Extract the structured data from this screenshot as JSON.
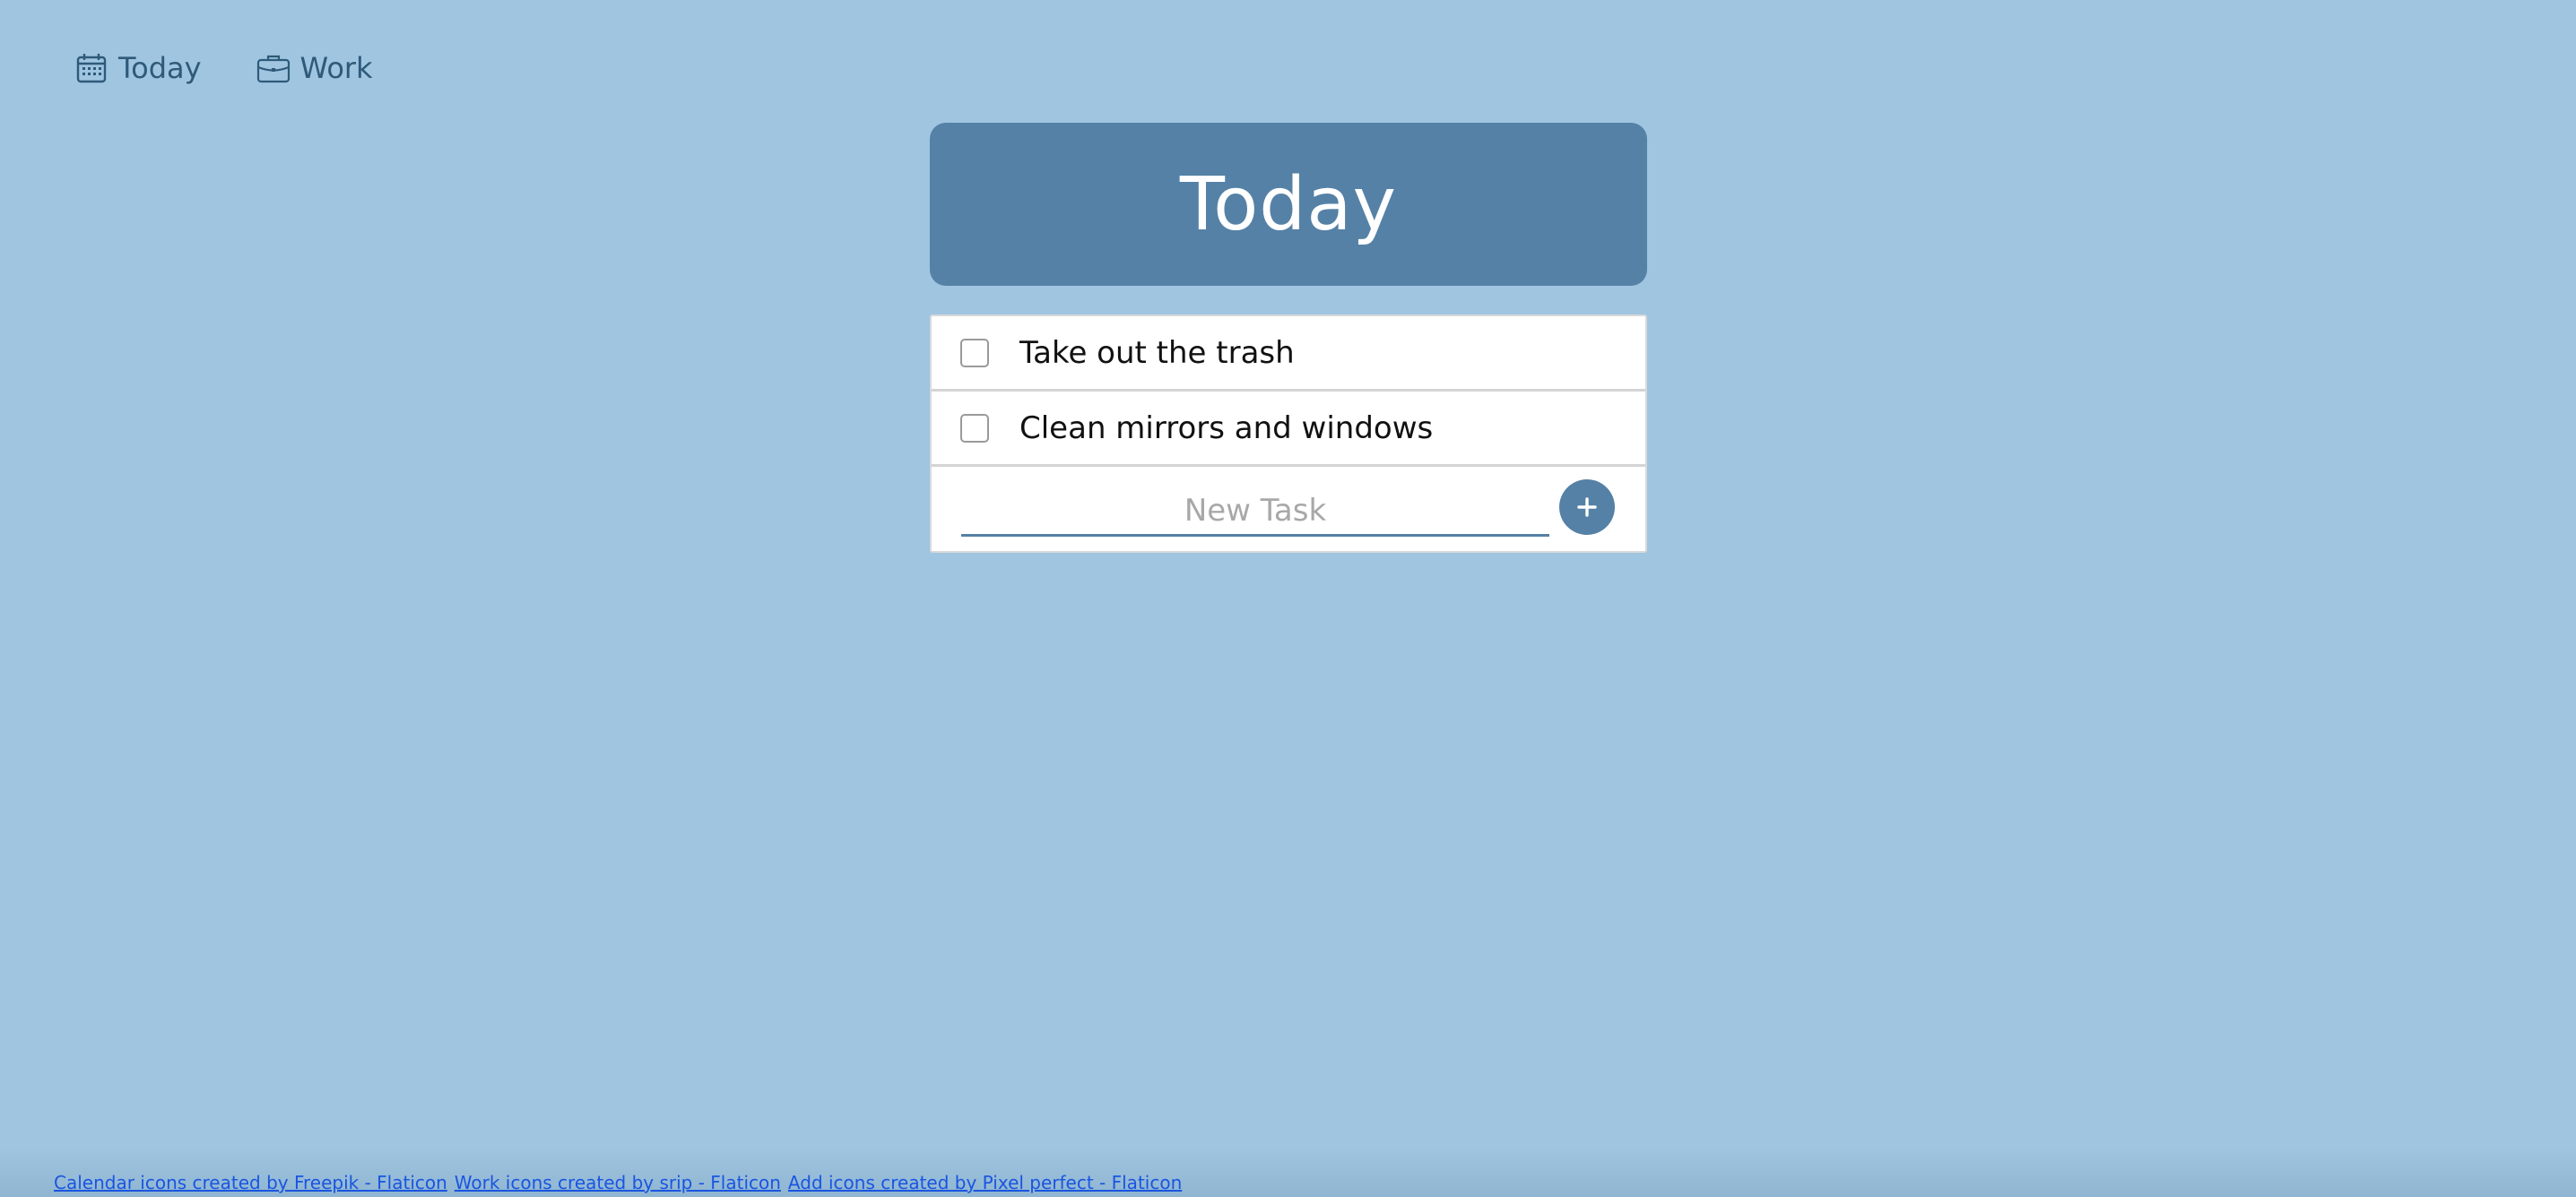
{
  "nav": {
    "items": [
      {
        "label": "Today",
        "icon": "calendar-icon"
      },
      {
        "label": "Work",
        "icon": "briefcase-icon"
      }
    ]
  },
  "list": {
    "title": "Today",
    "tasks": [
      {
        "text": "Take out the trash",
        "done": false
      },
      {
        "text": "Clean mirrors and windows",
        "done": false
      }
    ],
    "new_task": {
      "placeholder": "New Task",
      "value": "",
      "add_icon": "plus-icon"
    }
  },
  "footer": {
    "links": [
      "Calendar icons created by Freepik - Flaticon",
      "Work icons created by srip - Flaticon",
      "Add icons created by Pixel perfect - Flaticon"
    ]
  },
  "colors": {
    "background": "#9fc5e0",
    "accent": "#5581a6",
    "nav_text": "#2f5a7a",
    "link": "#1a55e0"
  }
}
